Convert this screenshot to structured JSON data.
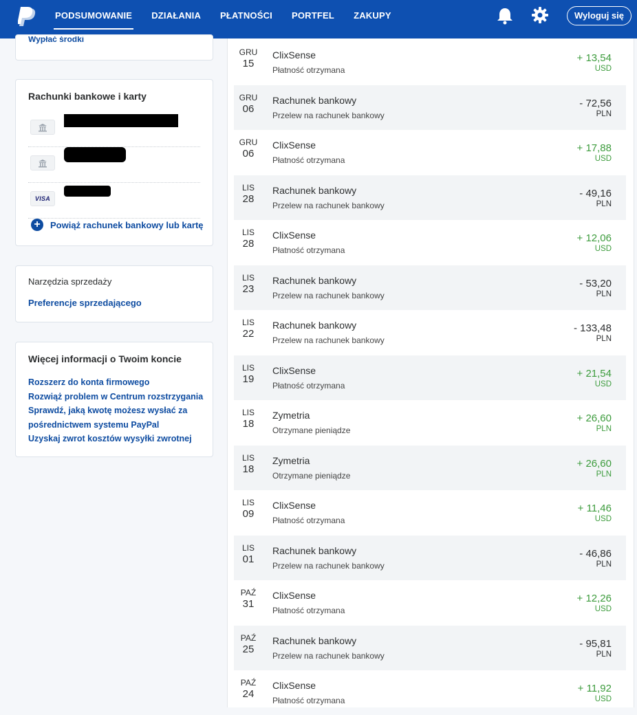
{
  "nav": {
    "items": [
      "PODSUMOWANIE",
      "DZIAŁANIA",
      "PŁATNOŚCI",
      "PORTFEL",
      "ZAKUPY"
    ],
    "active": "PODSUMOWANIE",
    "logout_label": "Wyloguj się"
  },
  "sidebar": {
    "withdraw_label": "Wypłać środki",
    "banks_title": "Rachunki bankowe i karty",
    "card_type": "VISA",
    "link_account_label": "Powiąż rachunek bankowy lub kartę",
    "sales_tools_title": "Narzędzia sprzedaży",
    "seller_prefs_label": "Preferencje sprzedającego",
    "more_info_title": "Więcej informacji o Twoim koncie",
    "more_info_links": [
      "Rozszerz do konta firmowego",
      "Rozwiąż problem w Centrum rozstrzygania",
      "Sprawdź, jaką kwotę możesz wysłać za",
      "pośrednictwem systemu PayPal",
      "Uzyskaj zwrot kosztów wysyłki zwrotnej"
    ]
  },
  "transactions": [
    {
      "month": "GRU",
      "day": "15",
      "name": "ClixSense",
      "desc": "Płatność otrzymana",
      "amount": "+ 13,54",
      "currency": "USD",
      "sign": "pos"
    },
    {
      "month": "GRU",
      "day": "06",
      "name": "Rachunek bankowy",
      "desc": "Przelew na rachunek bankowy",
      "amount": "- 72,56",
      "currency": "PLN",
      "sign": "neg"
    },
    {
      "month": "GRU",
      "day": "06",
      "name": "ClixSense",
      "desc": "Płatność otrzymana",
      "amount": "+ 17,88",
      "currency": "USD",
      "sign": "pos"
    },
    {
      "month": "LIS",
      "day": "28",
      "name": "Rachunek bankowy",
      "desc": "Przelew na rachunek bankowy",
      "amount": "- 49,16",
      "currency": "PLN",
      "sign": "neg"
    },
    {
      "month": "LIS",
      "day": "28",
      "name": "ClixSense",
      "desc": "Płatność otrzymana",
      "amount": "+ 12,06",
      "currency": "USD",
      "sign": "pos"
    },
    {
      "month": "LIS",
      "day": "23",
      "name": "Rachunek bankowy",
      "desc": "Przelew na rachunek bankowy",
      "amount": "- 53,20",
      "currency": "PLN",
      "sign": "neg"
    },
    {
      "month": "LIS",
      "day": "22",
      "name": "Rachunek bankowy",
      "desc": "Przelew na rachunek bankowy",
      "amount": "- 133,48",
      "currency": "PLN",
      "sign": "neg"
    },
    {
      "month": "LIS",
      "day": "19",
      "name": "ClixSense",
      "desc": "Płatność otrzymana",
      "amount": "+ 21,54",
      "currency": "USD",
      "sign": "pos"
    },
    {
      "month": "LIS",
      "day": "18",
      "name": "Zymetria",
      "desc": "Otrzymane pieniądze",
      "amount": "+ 26,60",
      "currency": "PLN",
      "sign": "pos"
    },
    {
      "month": "LIS",
      "day": "18",
      "name": "Zymetria",
      "desc": "Otrzymane pieniądze",
      "amount": "+ 26,60",
      "currency": "PLN",
      "sign": "pos"
    },
    {
      "month": "LIS",
      "day": "09",
      "name": "ClixSense",
      "desc": "Płatność otrzymana",
      "amount": "+ 11,46",
      "currency": "USD",
      "sign": "pos"
    },
    {
      "month": "LIS",
      "day": "01",
      "name": "Rachunek bankowy",
      "desc": "Przelew na rachunek bankowy",
      "amount": "- 46,86",
      "currency": "PLN",
      "sign": "neg"
    },
    {
      "month": "PAŹ",
      "day": "31",
      "name": "ClixSense",
      "desc": "Płatność otrzymana",
      "amount": "+ 12,26",
      "currency": "USD",
      "sign": "pos"
    },
    {
      "month": "PAŹ",
      "day": "25",
      "name": "Rachunek bankowy",
      "desc": "Przelew na rachunek bankowy",
      "amount": "- 95,81",
      "currency": "PLN",
      "sign": "neg"
    },
    {
      "month": "PAŹ",
      "day": "24",
      "name": "ClixSense",
      "desc": "Płatność otrzymana",
      "amount": "+ 11,92",
      "currency": "USD",
      "sign": "pos"
    }
  ],
  "colors": {
    "brand": "#0e50b1",
    "link": "#0e4ca1",
    "positive": "#3c9b3c"
  }
}
